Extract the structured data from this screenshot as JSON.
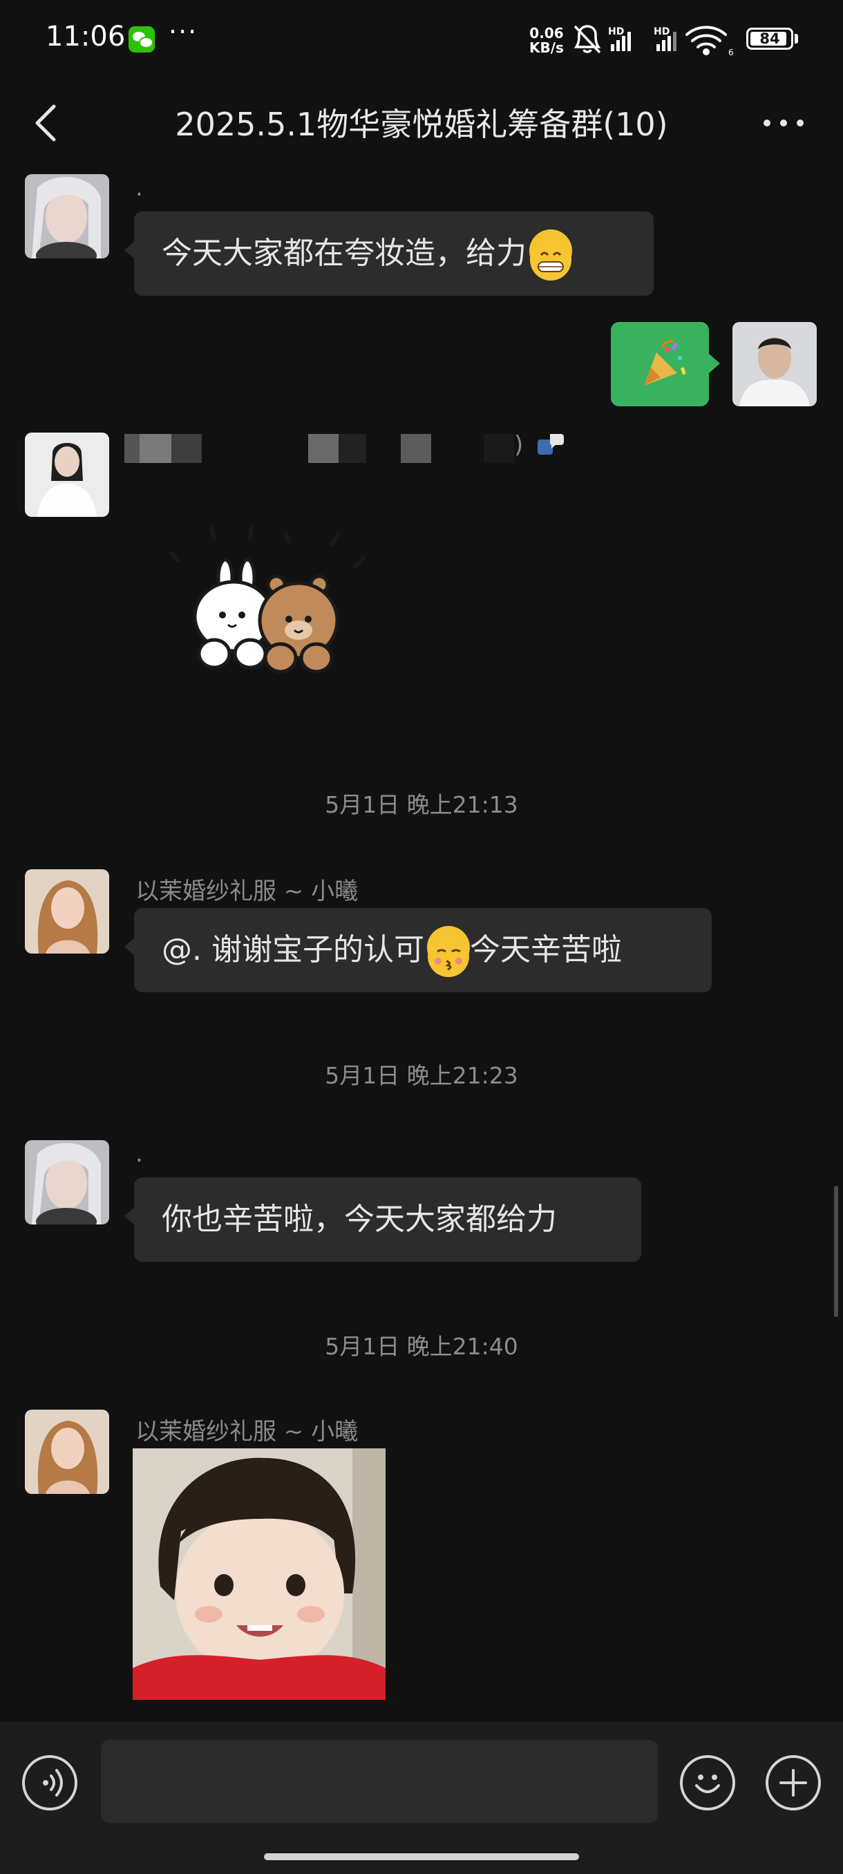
{
  "status_bar": {
    "time": "11:06",
    "dots": "···",
    "net_speed_value": "0.06",
    "net_speed_unit": "KB/s",
    "hd1": "HD",
    "hd2": "HD",
    "wifi_sub": "6",
    "battery_level": "84"
  },
  "header": {
    "title": "2025.5.1物华豪悦婚礼筹备群(10)"
  },
  "messages": [
    {
      "sender": ".",
      "text": "今天大家都在夸妆造，给力"
    },
    {
      "sender_hidden": ")"
    },
    {
      "timestamp": "5月1日 晚上21:13"
    },
    {
      "sender": "以茉婚纱礼服 ~ 小曦",
      "text_a": "@. 谢谢宝子的认可",
      "text_b": "今天辛苦啦"
    },
    {
      "timestamp": "5月1日 晚上21:23"
    },
    {
      "sender": ".",
      "text": "你也辛苦啦，今天大家都给力"
    },
    {
      "timestamp": "5月1日 晚上21:40"
    },
    {
      "sender": "以茉婚纱礼服 ~ 小曦"
    }
  ],
  "icons": [
    "back-arrow-icon",
    "more-icon",
    "voice-icon",
    "emoji-icon",
    "plus-icon"
  ],
  "colors": {
    "background": "#111111",
    "bubble": "#2c2c2c",
    "my_bubble": "#39b25f"
  }
}
